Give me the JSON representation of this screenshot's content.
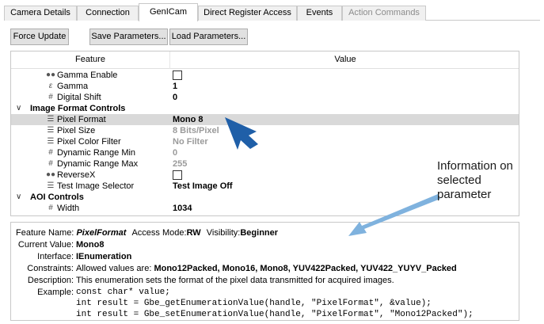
{
  "tabs": [
    {
      "label": "Camera Details"
    },
    {
      "label": "Connection"
    },
    {
      "label": "GenICam"
    },
    {
      "label": "Direct Register Access"
    },
    {
      "label": "Events"
    },
    {
      "label": "Action Commands"
    }
  ],
  "toolbar": {
    "force_update": "Force Update",
    "save_params": "Save Parameters...",
    "load_params": "Load Parameters..."
  },
  "grid": {
    "header_feature": "Feature",
    "header_value": "Value",
    "rows": [
      {
        "icon": "boolean-icon",
        "glyph": "●●",
        "label": "Gamma Enable",
        "value": ""
      },
      {
        "icon": "float-icon",
        "glyph": "ε",
        "label": "Gamma",
        "value": "1"
      },
      {
        "icon": "integer-icon",
        "glyph": "#",
        "label": "Digital Shift",
        "value": "0"
      },
      {
        "label": "Image Format Controls"
      },
      {
        "icon": "enumeration-icon",
        "glyph": "☰",
        "label": "Pixel Format",
        "value": "Mono 8"
      },
      {
        "icon": "enumeration-icon",
        "glyph": "☰",
        "label": "Pixel Size",
        "value": "8 Bits/Pixel"
      },
      {
        "icon": "enumeration-icon",
        "glyph": "☰",
        "label": "Pixel Color Filter",
        "value": "No Filter"
      },
      {
        "icon": "integer-icon",
        "glyph": "#",
        "label": "Dynamic Range Min",
        "value": "0"
      },
      {
        "icon": "integer-icon",
        "glyph": "#",
        "label": "Dynamic Range Max",
        "value": "255"
      },
      {
        "icon": "boolean-icon",
        "glyph": "●●",
        "label": "ReverseX",
        "value": ""
      },
      {
        "icon": "enumeration-icon",
        "glyph": "☰",
        "label": "Test Image Selector",
        "value": "Test Image Off"
      },
      {
        "label": "AOI Controls"
      },
      {
        "icon": "integer-icon",
        "glyph": "#",
        "label": "Width",
        "value": "1034"
      }
    ]
  },
  "info": {
    "feature_name_label": "Feature Name:",
    "feature_name_value": "PixelFormat",
    "access_mode_label": "Access Mode:",
    "access_mode_value": "RW",
    "visibility_label": "Visibility:",
    "visibility_value": "Beginner",
    "current_value_label": "Current Value:",
    "current_value": "Mono8",
    "interface_label": "Interface:",
    "interface_value": "IEnumeration",
    "constraints_label": "Constraints:",
    "constraints_prefix": "Allowed values are:",
    "constraints_values": "Mono12Packed, Mono16, Mono8, YUV422Packed, YUV422_YUYV_Packed",
    "description_label": "Description:",
    "description_value": "This enumeration sets the format of the pixel data transmitted for acquired images.",
    "example_label": "Example:",
    "example_lines": [
      "const char* value;",
      "int result = Gbe_getEnumerationValue(handle, \"PixelFormat\", &value);",
      "int result = Gbe_setEnumerationValue(handle, \"PixelFormat\", \"Mono12Packed\");"
    ]
  },
  "annotation": {
    "lines": [
      "Information on",
      "selected",
      "parameter"
    ]
  },
  "colors": {
    "selected_row": "#d9d9d9",
    "arrow_dark_blue": "#1f5fa8",
    "arrow_light_blue": "#7fb2de"
  }
}
